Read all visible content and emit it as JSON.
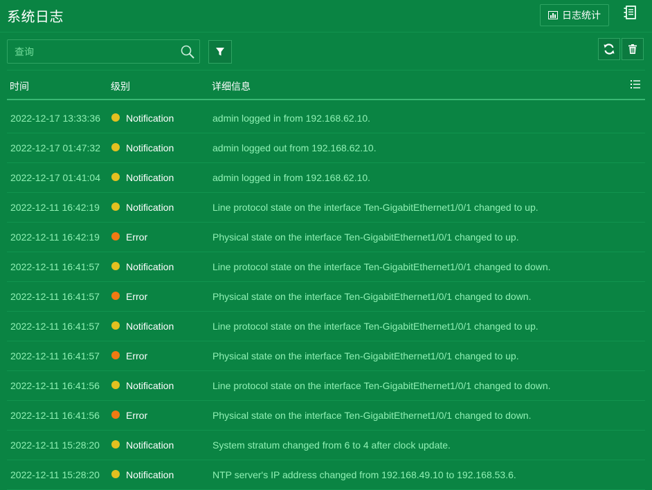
{
  "header": {
    "title": "系统日志",
    "stats_button_label": "日志统计"
  },
  "toolbar": {
    "search_placeholder": "查询"
  },
  "table": {
    "columns": [
      "时间",
      "级别",
      "详细信息"
    ],
    "level_colors": {
      "Notification": "#e3c020",
      "Error": "#f07a12"
    },
    "rows": [
      {
        "time": "2022-12-17 13:33:36",
        "level": "Notification",
        "detail": "admin logged in from 192.168.62.10."
      },
      {
        "time": "2022-12-17 01:47:32",
        "level": "Notification",
        "detail": "admin logged out from 192.168.62.10."
      },
      {
        "time": "2022-12-17 01:41:04",
        "level": "Notification",
        "detail": "admin logged in from 192.168.62.10."
      },
      {
        "time": "2022-12-11 16:42:19",
        "level": "Notification",
        "detail": "Line protocol state on the interface Ten-GigabitEthernet1/0/1 changed to up."
      },
      {
        "time": "2022-12-11 16:42:19",
        "level": "Error",
        "detail": "Physical state on the interface Ten-GigabitEthernet1/0/1 changed to up."
      },
      {
        "time": "2022-12-11 16:41:57",
        "level": "Notification",
        "detail": "Line protocol state on the interface Ten-GigabitEthernet1/0/1 changed to down."
      },
      {
        "time": "2022-12-11 16:41:57",
        "level": "Error",
        "detail": "Physical state on the interface Ten-GigabitEthernet1/0/1 changed to down."
      },
      {
        "time": "2022-12-11 16:41:57",
        "level": "Notification",
        "detail": "Line protocol state on the interface Ten-GigabitEthernet1/0/1 changed to up."
      },
      {
        "time": "2022-12-11 16:41:57",
        "level": "Error",
        "detail": "Physical state on the interface Ten-GigabitEthernet1/0/1 changed to up."
      },
      {
        "time": "2022-12-11 16:41:56",
        "level": "Notification",
        "detail": "Line protocol state on the interface Ten-GigabitEthernet1/0/1 changed to down."
      },
      {
        "time": "2022-12-11 16:41:56",
        "level": "Error",
        "detail": "Physical state on the interface Ten-GigabitEthernet1/0/1 changed to down."
      },
      {
        "time": "2022-12-11 15:28:20",
        "level": "Notification",
        "detail": "System stratum changed from 6 to 4 after clock update."
      },
      {
        "time": "2022-12-11 15:28:20",
        "level": "Notification",
        "detail": "NTP server's IP address changed from 192.168.49.10 to 192.168.53.6."
      }
    ]
  },
  "icons": {
    "stats": "bar-chart-icon",
    "book": "notebook-icon",
    "search": "search-icon",
    "filter": "filter-icon",
    "refresh": "refresh-icon",
    "delete": "trash-icon",
    "columns": "list-icon"
  }
}
